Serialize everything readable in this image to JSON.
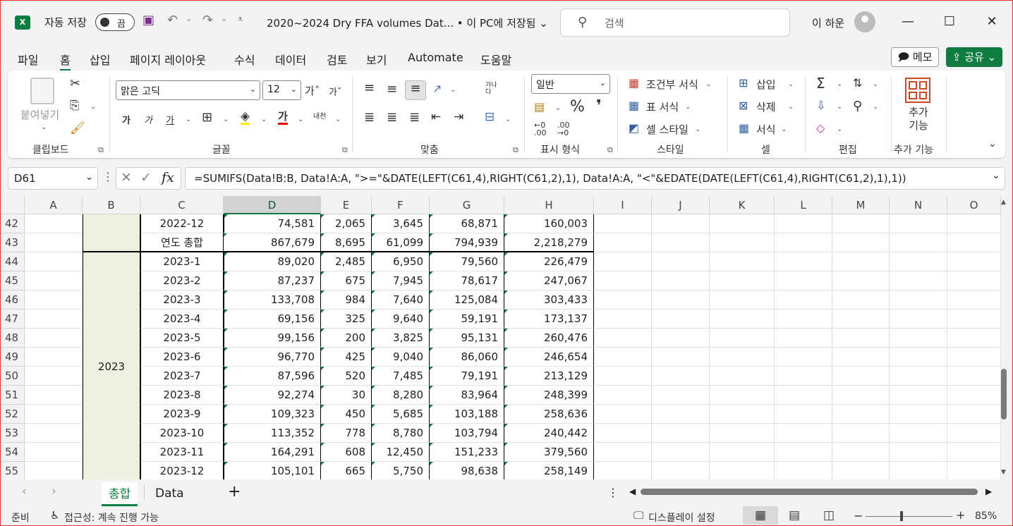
{
  "titlebar": {
    "app_icon": "X",
    "autosave_label": "자동 저장",
    "autosave_state": "끔",
    "title": "2020~2024 Dry FFA volumes Dat... • 이 PC에 저장됨 ⌄",
    "search_placeholder": "검색",
    "user": "이 하운"
  },
  "menu": [
    "파일",
    "홈",
    "삽입",
    "페이지 레이아웃",
    "수식",
    "데이터",
    "검토",
    "보기",
    "Automate",
    "도움말"
  ],
  "menu_active": "홈",
  "memo_label": "메모",
  "share_label": "공유",
  "ribbon": {
    "clipboard": {
      "paste": "붙여넣기",
      "group": "클립보드"
    },
    "font": {
      "name": "맑은 고딕",
      "size": "12",
      "group": "글꼴",
      "bold": "가",
      "italic": "가",
      "underline": "가",
      "fontcolor": "가",
      "phonetic": "내천"
    },
    "align": {
      "group": "맞춤",
      "wrap": "가나다"
    },
    "number": {
      "format": "일반",
      "group": "표시 형식"
    },
    "styles": {
      "cond": "조건부 서식",
      "table": "표 서식",
      "cell": "셀 스타일",
      "group": "스타일"
    },
    "cells": {
      "insert": "삽입",
      "delete": "삭제",
      "format": "서식",
      "group": "셀"
    },
    "editing": {
      "group": "편집"
    },
    "addins": {
      "label": "추가\n기능",
      "group": "추가 기능"
    }
  },
  "namebox": "D61",
  "formula": "=SUMIFS(Data!B:B, Data!A:A, \">=\"&DATE(LEFT(C61,4),RIGHT(C61,2),1), Data!A:A, \"<\"&EDATE(DATE(LEFT(C61,4),RIGHT(C61,2),1),1))",
  "columns": [
    "A",
    "B",
    "C",
    "D",
    "E",
    "F",
    "G",
    "H",
    "I",
    "J",
    "K",
    "L",
    "M",
    "N",
    "O"
  ],
  "selected_column": "D",
  "rows": [
    {
      "num": "42",
      "c": "2022-12",
      "d": "74,581",
      "e": "2,065",
      "f": "3,645",
      "g": "68,871",
      "h": "160,003"
    },
    {
      "num": "43",
      "c": "연도 총합",
      "d": "867,679",
      "e": "8,695",
      "f": "61,099",
      "g": "794,939",
      "h": "2,218,279"
    },
    {
      "num": "44",
      "c": "2023-1",
      "d": "89,020",
      "e": "2,485",
      "f": "6,950",
      "g": "79,560",
      "h": "226,479"
    },
    {
      "num": "45",
      "c": "2023-2",
      "d": "87,237",
      "e": "675",
      "f": "7,945",
      "g": "78,617",
      "h": "247,067"
    },
    {
      "num": "46",
      "c": "2023-3",
      "d": "133,708",
      "e": "984",
      "f": "7,640",
      "g": "125,084",
      "h": "303,433"
    },
    {
      "num": "47",
      "c": "2023-4",
      "d": "69,156",
      "e": "325",
      "f": "9,640",
      "g": "59,191",
      "h": "173,137"
    },
    {
      "num": "48",
      "c": "2023-5",
      "d": "99,156",
      "e": "200",
      "f": "3,825",
      "g": "95,131",
      "h": "260,476"
    },
    {
      "num": "49",
      "c": "2023-6",
      "d": "96,770",
      "e": "425",
      "f": "9,040",
      "g": "86,060",
      "h": "246,654"
    },
    {
      "num": "50",
      "c": "2023-7",
      "d": "87,596",
      "e": "520",
      "f": "7,485",
      "g": "79,191",
      "h": "213,129"
    },
    {
      "num": "51",
      "c": "2023-8",
      "d": "92,274",
      "e": "30",
      "f": "8,280",
      "g": "83,964",
      "h": "248,399"
    },
    {
      "num": "52",
      "c": "2023-9",
      "d": "109,323",
      "e": "450",
      "f": "5,685",
      "g": "103,188",
      "h": "258,636"
    },
    {
      "num": "53",
      "c": "2023-10",
      "d": "113,352",
      "e": "778",
      "f": "8,780",
      "g": "103,794",
      "h": "240,442"
    },
    {
      "num": "54",
      "c": "2023-11",
      "d": "164,291",
      "e": "608",
      "f": "12,450",
      "g": "151,233",
      "h": "379,560"
    },
    {
      "num": "55",
      "c": "2023-12",
      "d": "105,101",
      "e": "665",
      "f": "5,750",
      "g": "98,638",
      "h": "258,149"
    }
  ],
  "year_label": "2023",
  "sheets": [
    "총합",
    "Data"
  ],
  "active_sheet": "총합",
  "status": {
    "ready": "준비",
    "accessibility": "접근성: 계속 진행 가능",
    "display_settings": "디스플레이 설정",
    "zoom": "85%"
  },
  "colors": {
    "accent": "#107c41",
    "year_fill": "#ebf1de"
  }
}
